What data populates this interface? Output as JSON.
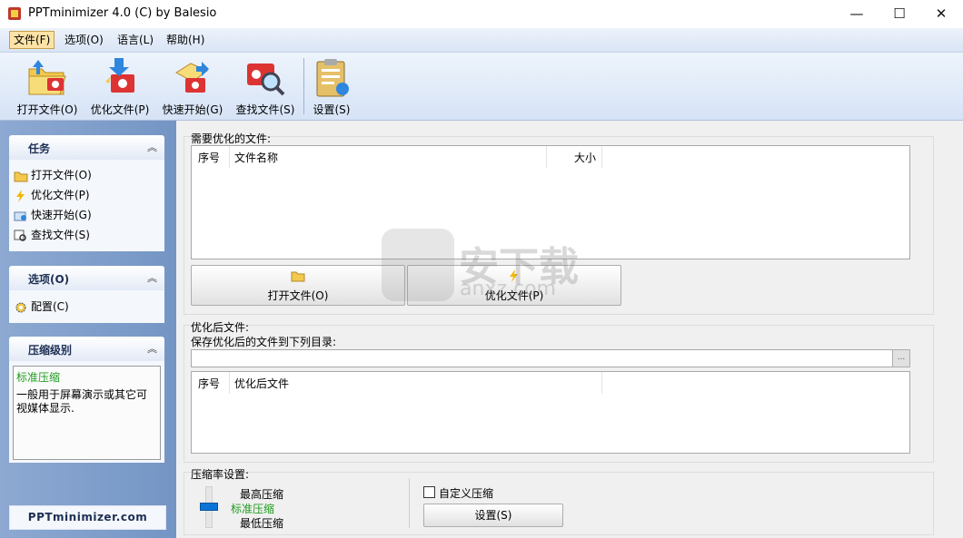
{
  "window": {
    "title": "PPTminimizer 4.0 (C) by Balesio"
  },
  "menu": [
    "文件(F)",
    "选项(O)",
    "语言(L)",
    "帮助(H)"
  ],
  "toolbar": [
    "打开文件(O)",
    "优化文件(P)",
    "快速开始(G)",
    "查找文件(S)",
    "设置(S)"
  ],
  "sidebar": {
    "tasks_title": "任务",
    "tasks": [
      "打开文件(O)",
      "优化文件(P)",
      "快速开始(G)",
      "查找文件(S)"
    ],
    "options_title": "选项(O)",
    "options": [
      "配置(C)"
    ],
    "compress_title": "压缩级别",
    "compress_name": "标准压缩",
    "compress_desc": "一般用于屏幕演示或其它可视媒体显示.",
    "logo": "PPTminimizer.com"
  },
  "source": {
    "label": "需要优化的文件:",
    "col_index": "序号",
    "col_name": "文件名称",
    "col_size": "大小",
    "open_button": "打开文件(O)",
    "optimize_button": "优化文件(P)"
  },
  "output": {
    "label": "优化后文件:",
    "dir_label": "保存优化后的文件到下列目录:",
    "path_value": "",
    "browse": "...",
    "col_index": "序号",
    "col_file": "优化后文件"
  },
  "compression": {
    "label": "压缩率设置:",
    "levels": [
      "最高压缩",
      "标准压缩",
      "最低压缩"
    ],
    "custom_label": "自定义压缩",
    "settings_button": "设置(S)"
  },
  "watermark": {
    "main": "安下载",
    "sub": "anxz.com"
  },
  "colors": {
    "accent": "#1f9c1f",
    "sidebar": "#7f9ccb",
    "menu_active": "#fde3a7"
  }
}
